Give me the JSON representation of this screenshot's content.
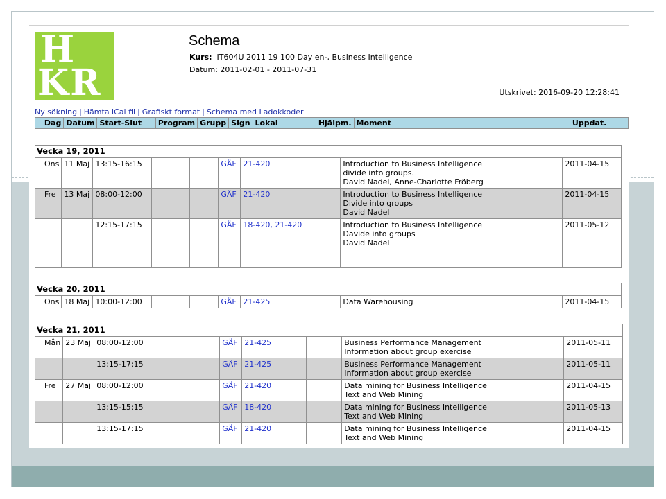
{
  "logo": {
    "line1": "H",
    "line2": "KR"
  },
  "title": "Schema",
  "kurs_label": "Kurs:",
  "kurs_value": "IT604U 2011 19 100 Day en-, Business Intelligence",
  "datum_label": "Datum:",
  "datum_value": "2011-02-01 - 2011-07-31",
  "printed": "Utskrivet: 2016-09-20 12:28:41",
  "links": [
    "Ny sökning",
    "Hämta iCal fil",
    "Grafiskt format",
    "Schema med Ladokkoder"
  ],
  "columns": [
    "Dag",
    "Datum",
    "Start-Slut",
    "Program",
    "Grupp",
    "Sign",
    "Lokal",
    "Hjälpm.",
    "Moment",
    "Uppdat."
  ],
  "weeks": [
    {
      "title": "Vecka 19, 2011",
      "rows": [
        {
          "dag": "Ons",
          "datum": "11 Maj",
          "tid": "13:15-16:15",
          "sign": "GÄF",
          "lokal": "21-420",
          "moment": [
            "Introduction to Business Intelligence",
            "divide into groups.",
            "David Nadel, Anne-Charlotte Fröberg"
          ],
          "uppdat": "2011-04-15"
        },
        {
          "dag": "Fre",
          "datum": "13 Maj",
          "tid": "08:00-12:00",
          "sign": "GÄF",
          "lokal": "21-420",
          "moment": [
            "Introduction to Business Intelligence",
            "Divide into groups",
            "David Nadel"
          ],
          "uppdat": "2011-04-15"
        },
        {
          "dag": "",
          "datum": "",
          "tid": "12:15-17:15",
          "sign": "GÄF",
          "lokal": "18-420, 21-420",
          "moment": [
            "Introduction to Business Intelligence",
            "Davide into groups",
            "David Nadel"
          ],
          "uppdat": "2011-05-12"
        }
      ]
    },
    {
      "title": "Vecka 20, 2011",
      "rows": [
        {
          "dag": "Ons",
          "datum": "18 Maj",
          "tid": "10:00-12:00",
          "sign": "GÄF",
          "lokal": "21-425",
          "moment": [
            "Data Warehousing"
          ],
          "uppdat": "2011-04-15"
        }
      ]
    },
    {
      "title": "Vecka 21, 2011",
      "rows": [
        {
          "dag": "Mån",
          "datum": "23 Maj",
          "tid": "08:00-12:00",
          "sign": "GÄF",
          "lokal": "21-425",
          "moment": [
            "Business Performance Management",
            "Information about group exercise"
          ],
          "uppdat": "2011-05-11"
        },
        {
          "dag": "",
          "datum": "",
          "tid": "13:15-17:15",
          "sign": "GÄF",
          "lokal": "21-425",
          "moment": [
            "Business Performance Management",
            "Information about group exercise"
          ],
          "uppdat": "2011-05-11"
        },
        {
          "dag": "Fre",
          "datum": "27 Maj",
          "tid": "08:00-12:00",
          "sign": "GÄF",
          "lokal": "21-420",
          "moment": [
            "Data mining for Business Intelligence",
            "Text and Web Mining"
          ],
          "uppdat": "2011-04-15"
        },
        {
          "dag": "",
          "datum": "",
          "tid": "13:15-15:15",
          "sign": "GÄF",
          "lokal": "18-420",
          "moment": [
            "Data mining for Business Intelligence",
            "Text and Web Mining"
          ],
          "uppdat": "2011-05-13"
        },
        {
          "dag": "",
          "datum": "",
          "tid": "13:15-17:15",
          "sign": "GÄF",
          "lokal": "21-420",
          "moment": [
            "Data mining for Business Intelligence",
            "Text and Web Mining"
          ],
          "uppdat": "2011-04-15"
        }
      ]
    }
  ]
}
